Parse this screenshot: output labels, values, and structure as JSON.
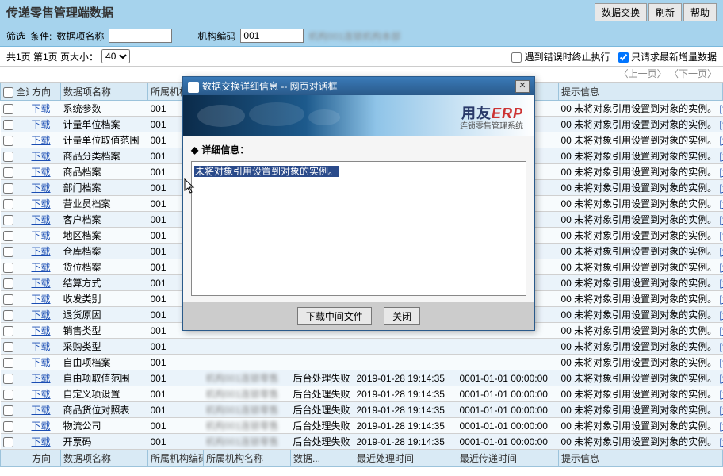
{
  "header": {
    "title": "传递零售管理端数据",
    "buttons": {
      "exchange": "数据交换",
      "refresh": "刷新",
      "help": "帮助"
    }
  },
  "filter": {
    "label_filter": "筛选",
    "label_cond": "条件:",
    "label_item": "数据项名称",
    "item_value": "",
    "label_org": "机构编码",
    "org_value": "001",
    "extra_blur": "机构001连锁机构本部"
  },
  "pager": {
    "summary": "共1页  第1页  页大小：",
    "page_size": "40",
    "stop_on_error": "遇到错误时终止执行",
    "only_latest": "只请求最新增量数据",
    "nav": "〈上一页〉 〈下一页〉"
  },
  "columns": {
    "c0": "全选",
    "c1": "方向",
    "c2": "数据项名称",
    "c3": "所属机构编码",
    "c4": "所属机构名称",
    "c5": "数据...",
    "c6": "最近处理时间",
    "c7": "最近传递时间",
    "c8": "提示信息"
  },
  "footer_row": {
    "c1": "方向",
    "c2": "数据项名称",
    "c3": "所属机构编码",
    "c4": "所属机构名称",
    "c5": "数据...",
    "c6": "最近处理时间",
    "c7": "最近传递时间",
    "c8": "提示信息"
  },
  "common": {
    "download": "下载",
    "org_code": "001",
    "status": "后台处理失败",
    "time1": "2019-01-28 19:14:35",
    "time2": "0001-01-01 00:00:00",
    "tip_prefix": "00 未将对象引用设置到对象的实例。",
    "detail": "[详细]"
  },
  "rows": [
    {
      "name": "系统参数"
    },
    {
      "name": "计量单位档案"
    },
    {
      "name": "计量单位取值范围"
    },
    {
      "name": "商品分类档案"
    },
    {
      "name": "商品档案"
    },
    {
      "name": "部门档案"
    },
    {
      "name": "营业员档案"
    },
    {
      "name": "客户档案"
    },
    {
      "name": "地区档案"
    },
    {
      "name": "仓库档案"
    },
    {
      "name": "货位档案"
    },
    {
      "name": "结算方式"
    },
    {
      "name": "收发类别"
    },
    {
      "name": "退货原因"
    },
    {
      "name": "销售类型"
    },
    {
      "name": "采购类型"
    },
    {
      "name": "自由项档案"
    },
    {
      "name": "自由项取值范围"
    },
    {
      "name": "自定义项设置"
    },
    {
      "name": "商品货位对照表"
    },
    {
      "name": "物流公司"
    },
    {
      "name": "开票码"
    }
  ],
  "modal": {
    "title": "数据交换详细信息 -- 网页对话框",
    "erp_prefix": "用友",
    "erp_brand": "ERP",
    "erp_sub": "连锁零售管理系统",
    "detail_label": "详细信息：",
    "message": "未将对象引用设置到对象的实例。",
    "btn_download": "下载中间文件",
    "btn_close": "关闭"
  }
}
